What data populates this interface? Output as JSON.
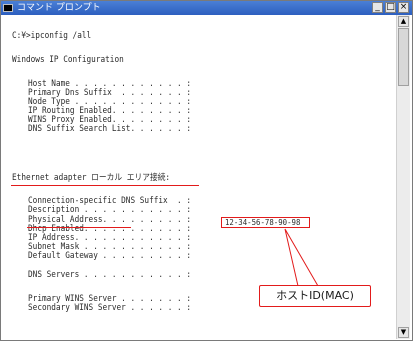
{
  "window": {
    "title": "コマンド プロンプト",
    "controls": {
      "minimize": "_",
      "maximize": "□",
      "close": "×"
    }
  },
  "console": {
    "command": "C:¥>ipconfig /all",
    "header": "Windows IP Configuration",
    "host_name": "Host Name . . . . . . . . . . . . :",
    "primary_dns_suffix": "Primary Dns Suffix  . . . . . . . :",
    "node_type": "Node Type . . . . . . . . . . . . :",
    "ip_routing": "IP Routing Enabled. . . . . . . . :",
    "wins_proxy": "WINS Proxy Enabled. . . . . . . . :",
    "dns_suffix_list": "DNS Suffix Search List. . . . . . :",
    "adapter_heading": "Ethernet adapter ローカル エリア接続:",
    "conn_dns_suffix": "Connection-specific DNS Suffix  . :",
    "description": "Description . . . . . . . . . . . :",
    "physical_address": "Physical Address. . . . . . . . . :",
    "dhcp_enabled": "Dhcp Enabled. . . . . . . . . . . :",
    "ip_address": "IP Address. . . . . . . . . . . . :",
    "subnet_mask": "Subnet Mask . . . . . . . . . . . :",
    "default_gateway": "Default Gateway . . . . . . . . . :",
    "dns_servers": "DNS Servers . . . . . . . . . . . :",
    "primary_wins": "Primary WINS Server . . . . . . . :",
    "secondary_wins": "Secondary WINS Server . . . . . . :"
  },
  "annotation": {
    "mac_value": "12-34-56-78-90-98",
    "callout_label": "ホストID(MAC)",
    "accent_color": "#e21b1b"
  },
  "scrollbar": {
    "up_arrow": "▲",
    "down_arrow": "▼"
  }
}
